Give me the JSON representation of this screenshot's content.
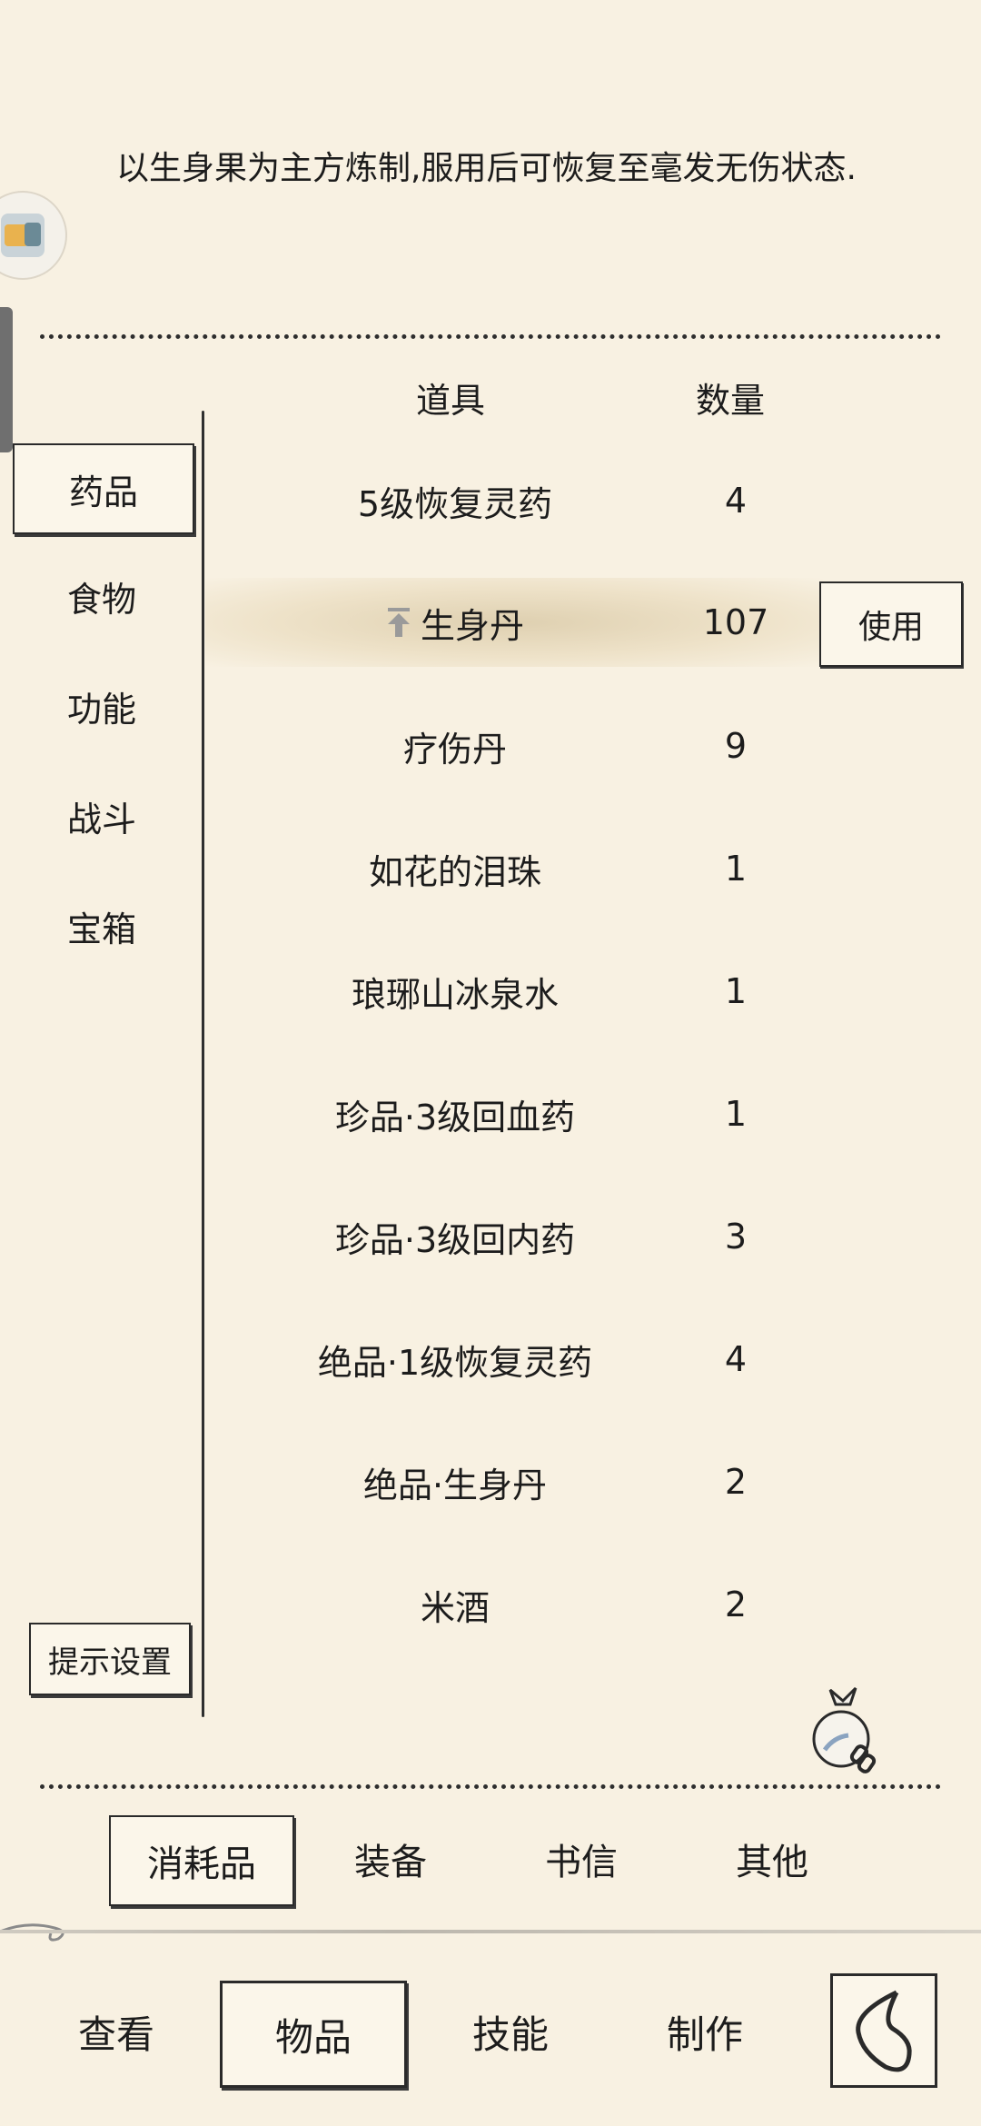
{
  "description": "以生身果为主方炼制,服用后可恢复至毫发无伤状态.",
  "categories": [
    "药品",
    "食物",
    "功能",
    "战斗",
    "宝箱"
  ],
  "hint_settings_label": "提示设置",
  "columns": {
    "item": "道具",
    "qty": "数量"
  },
  "items": [
    {
      "name": "5级恢复灵药",
      "qty": "4"
    },
    {
      "name": "生身丹",
      "qty": "107",
      "selected": true
    },
    {
      "name": "疗伤丹",
      "qty": "9"
    },
    {
      "name": "如花的泪珠",
      "qty": "1"
    },
    {
      "name": "琅琊山冰泉水",
      "qty": "1"
    },
    {
      "name": "珍品·3级回血药",
      "qty": "1"
    },
    {
      "name": "珍品·3级回内药",
      "qty": "3"
    },
    {
      "name": "绝品·1级恢复灵药",
      "qty": "4"
    },
    {
      "name": "绝品·生身丹",
      "qty": "2"
    },
    {
      "name": "米酒",
      "qty": "2"
    }
  ],
  "use_button_label": "使用",
  "tabs": [
    "消耗品",
    "装备",
    "书信",
    "其他"
  ],
  "nav": [
    "查看",
    "物品",
    "技能",
    "制作"
  ]
}
